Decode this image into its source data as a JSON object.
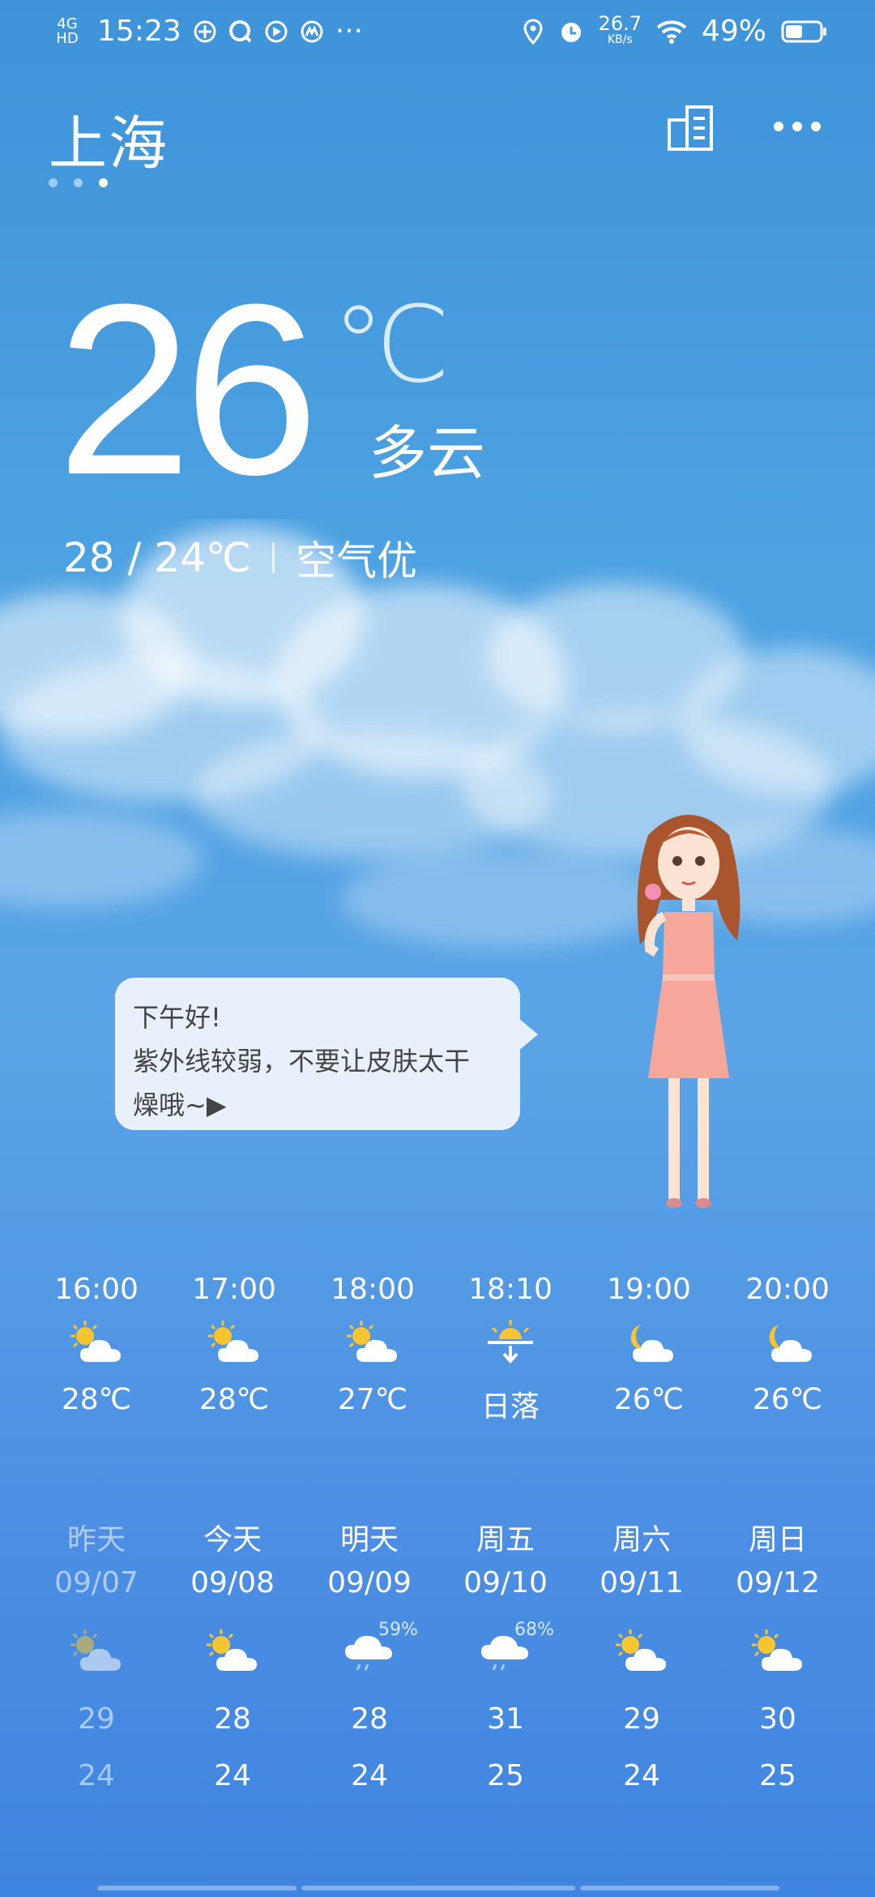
{
  "status_bar": {
    "network": "4G HD",
    "time": "15:23",
    "speed_value": "26.7",
    "speed_unit": "KB/s",
    "battery": "49%",
    "overflow": "···"
  },
  "header": {
    "city": "上海",
    "page_count": 3,
    "active_page": 2
  },
  "current": {
    "temperature": "26",
    "unit": "℃",
    "condition": "多云",
    "high_low": "28 / 24℃",
    "air_quality": "空气优"
  },
  "assistant": {
    "greeting": "下午好!",
    "line1": "紫外线较弱，不要让皮肤太干",
    "line2": "燥哦~▶"
  },
  "hourly": [
    {
      "time": "16:00",
      "icon": "partly-cloudy-day-icon",
      "temp": "28℃"
    },
    {
      "time": "17:00",
      "icon": "partly-cloudy-day-icon",
      "temp": "28℃"
    },
    {
      "time": "18:00",
      "icon": "partly-cloudy-day-icon",
      "temp": "27℃"
    },
    {
      "time": "18:10",
      "icon": "sunset-icon",
      "temp": "日落"
    },
    {
      "time": "19:00",
      "icon": "partly-cloudy-night-icon",
      "temp": "26℃"
    },
    {
      "time": "20:00",
      "icon": "partly-cloudy-night-icon",
      "temp": "26℃"
    }
  ],
  "daily": [
    {
      "name": "昨天",
      "date": "09/07",
      "icon": "partly-cloudy-day-icon",
      "precip": "",
      "high": "29",
      "low": "24",
      "past": true
    },
    {
      "name": "今天",
      "date": "09/08",
      "icon": "partly-cloudy-day-icon",
      "precip": "",
      "high": "28",
      "low": "24",
      "past": false
    },
    {
      "name": "明天",
      "date": "09/09",
      "icon": "rain-icon",
      "precip": "59%",
      "high": "28",
      "low": "24",
      "past": false
    },
    {
      "name": "周五",
      "date": "09/10",
      "icon": "rain-icon",
      "precip": "68%",
      "high": "31",
      "low": "25",
      "past": false
    },
    {
      "name": "周六",
      "date": "09/11",
      "icon": "partly-cloudy-day-icon",
      "precip": "",
      "high": "29",
      "low": "24",
      "past": false
    },
    {
      "name": "周日",
      "date": "09/12",
      "icon": "partly-cloudy-day-icon",
      "precip": "",
      "high": "30",
      "low": "25",
      "past": false
    }
  ],
  "colors": {
    "sky_top": "#3f93d9",
    "sky_bottom": "#3f84e0",
    "sun": "#f7c531",
    "bubble": "#e8f1fb"
  }
}
